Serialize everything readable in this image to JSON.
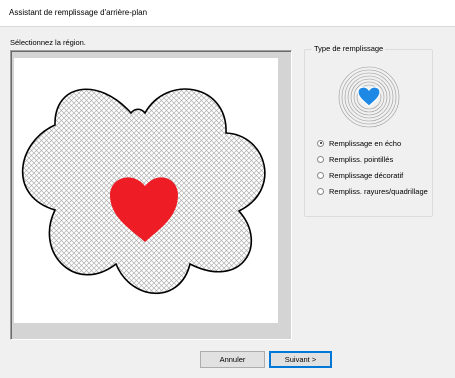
{
  "window": {
    "title": "Assistant de remplissage d'arrière-plan"
  },
  "region": {
    "label": "Sélectionnez la région."
  },
  "fill_type": {
    "legend": "Type de remplissage",
    "options": [
      {
        "label": "Remplissage en écho",
        "checked": true
      },
      {
        "label": "Rempliss. pointillés",
        "checked": false
      },
      {
        "label": "Remplissage décoratif",
        "checked": false
      },
      {
        "label": "Rempliss. rayures/quadrillage",
        "checked": false
      }
    ]
  },
  "buttons": {
    "cancel": "Annuler",
    "next": "Suivant >"
  },
  "colors": {
    "heart": "#ee1c24",
    "preview_heart": "#1e88e5",
    "frame_bg": "#d4d4d4"
  }
}
